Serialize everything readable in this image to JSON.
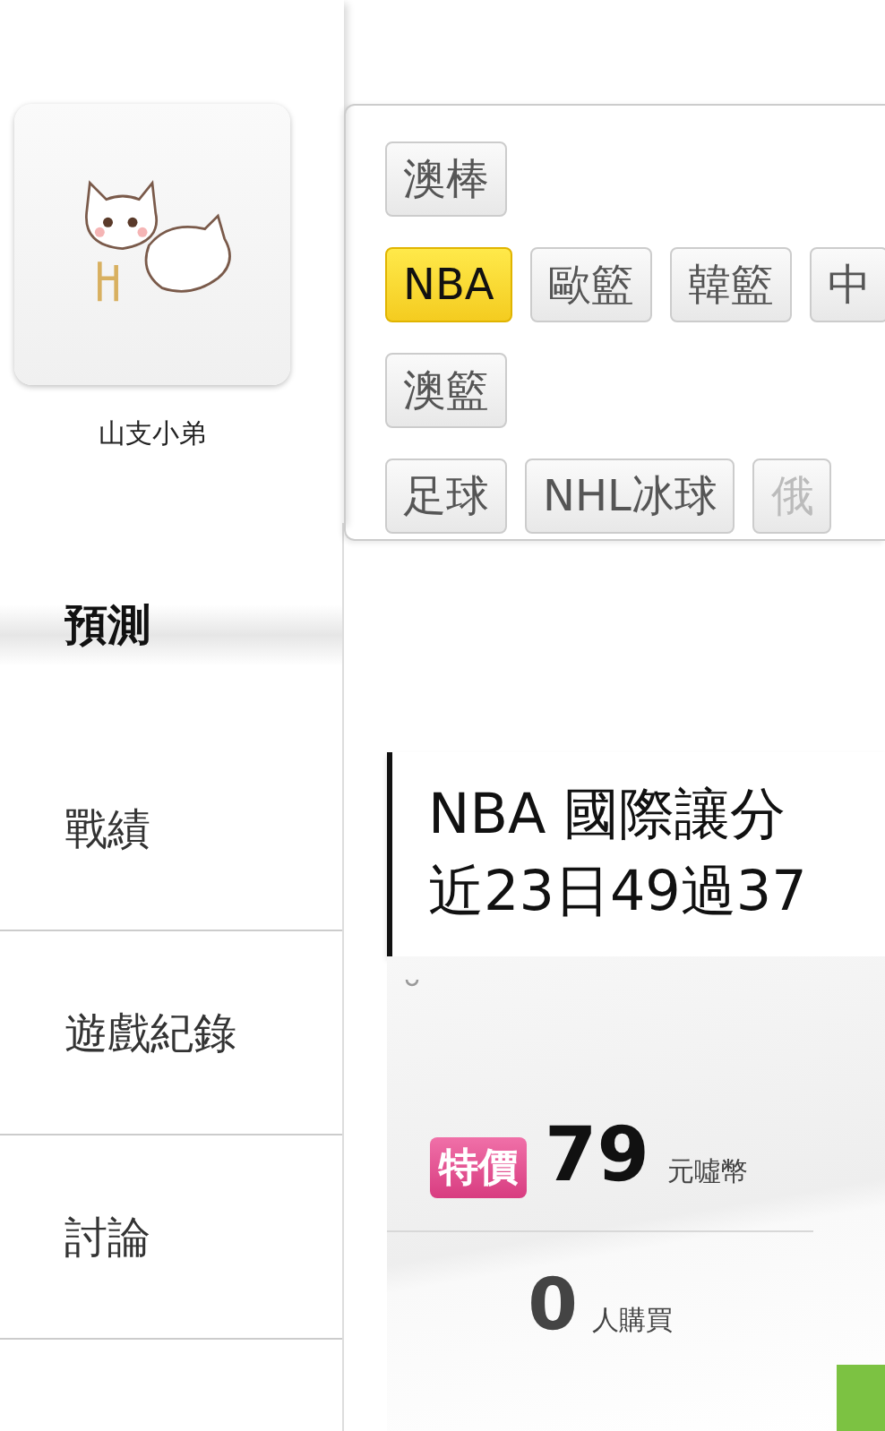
{
  "profile": {
    "name": "山支小弟"
  },
  "tag_rows": [
    [
      {
        "label": "澳棒",
        "selected": false,
        "disabled": false
      }
    ],
    [
      {
        "label": "NBA",
        "selected": true,
        "disabled": false
      },
      {
        "label": "歐籃",
        "selected": false,
        "disabled": false
      },
      {
        "label": "韓籃",
        "selected": false,
        "disabled": false
      },
      {
        "label": "中",
        "selected": false,
        "disabled": false
      }
    ],
    [
      {
        "label": "澳籃",
        "selected": false,
        "disabled": false
      }
    ],
    [
      {
        "label": "足球",
        "selected": false,
        "disabled": false
      },
      {
        "label": "NHL冰球",
        "selected": false,
        "disabled": false
      },
      {
        "label": "俄",
        "selected": false,
        "disabled": true
      }
    ]
  ],
  "menu": [
    {
      "label": "預測",
      "selected": true
    },
    {
      "label": "戰績",
      "selected": false
    },
    {
      "label": "遊戲紀錄",
      "selected": false
    },
    {
      "label": "討論",
      "selected": false
    }
  ],
  "card": {
    "title_lines": [
      "NBA 國際讓分",
      "近23日49過37"
    ],
    "badge": "特價",
    "price": "79",
    "currency": "元噓幣",
    "buyers": "0",
    "buyers_label": "人購買"
  }
}
